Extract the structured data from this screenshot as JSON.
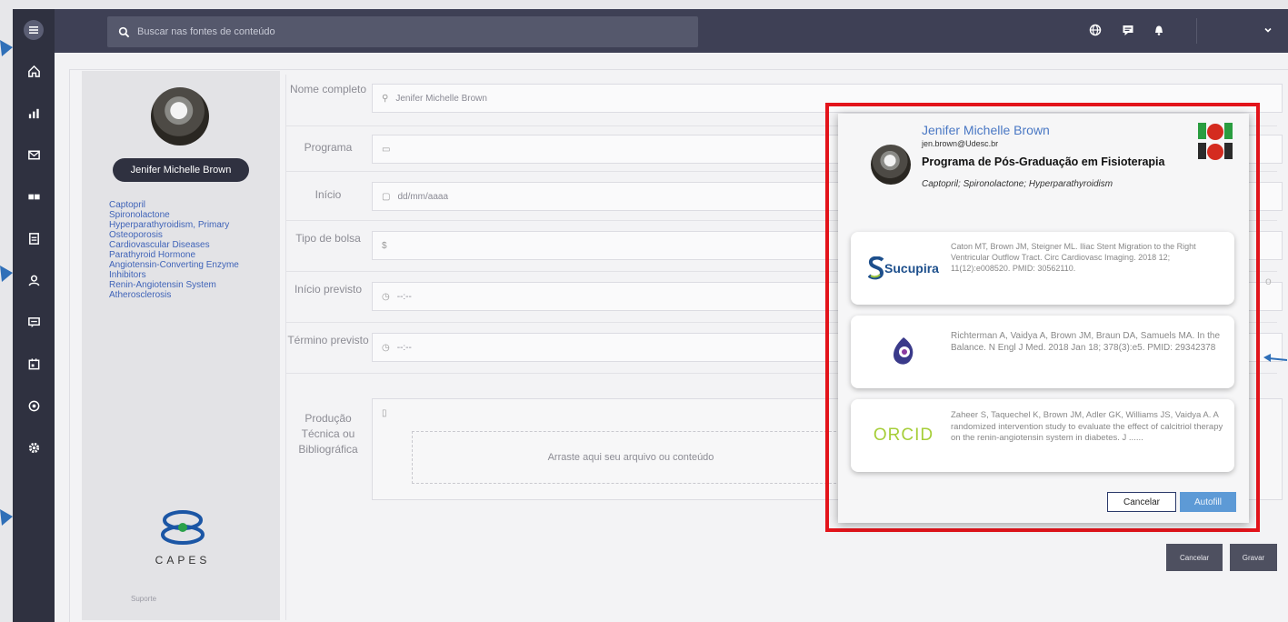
{
  "search": {
    "placeholder": "Buscar nas fontes de conteúdo"
  },
  "profile": {
    "name": "Jenifer Michelle Brown",
    "keywords": [
      "Captopril",
      "Spironolactone",
      "Hyperparathyroidism, Primary",
      "Osteoporosis",
      "Cardiovascular Diseases",
      "Parathyroid Hormone",
      "Angiotensin-Converting Enzyme",
      "Inhibitors",
      "Renin-Angiotensin System",
      "Atherosclerosis"
    ],
    "logo_text": "CAPES",
    "support": "Suporte"
  },
  "form": {
    "fields": [
      {
        "label": "Nome completo",
        "value": "Jenifer Michelle Brown",
        "icon": "person-icon"
      },
      {
        "label": "Programa",
        "value": "",
        "icon": "building-icon"
      },
      {
        "label": "Início",
        "value": "dd/mm/aaaa",
        "icon": "calendar-icon"
      },
      {
        "label": "Tipo de bolsa",
        "value": "",
        "icon": "dollar-icon"
      },
      {
        "label": "Início previsto",
        "value": "--:--",
        "icon": "clock-icon"
      },
      {
        "label": "Término previsto",
        "value": "--:--",
        "icon": "clock-icon"
      },
      {
        "label": "Produção Técnica ou Bibliográfica",
        "value": "",
        "icon": "file-icon"
      }
    ],
    "dropzone": "Arraste aqui seu arquivo ou conteúdo",
    "currency_symbol": "$",
    "cancel_label": "Cancelar",
    "save_label": "Gravar",
    "edge_char": "o"
  },
  "popup": {
    "name": "Jenifer Michelle Brown",
    "email": "jen.brown@Udesc.br",
    "program": "Programa de Pós-Graduação em Fisioterapia",
    "keywords": "Captopril; Spironolactone; Hyperparathyroidism",
    "sources": [
      {
        "logo": "Sucupira",
        "text": "Caton MT, Brown JM, Steigner ML. Iliac Stent Migration to the Right Ventricular Outflow Tract. Circ Cardiovasc Imaging. 2018 12; 11(12):e008520. PMID: 30562110."
      },
      {
        "logo": "PubMed",
        "text": "Richterman A, Vaidya A, Brown JM, Braun DA, Samuels MA. In the Balance. N Engl J Med. 2018 Jan 18; 378(3):e5. PMID: 29342378"
      },
      {
        "logo": "ORCID",
        "text": "Zaheer S, Taquechel K, Brown JM, Adler GK, Williams JS, Vaidya A. A randomized intervention study to evaluate the effect of calcitriol therapy on the renin-angiotensin system in diabetes. J ......"
      }
    ],
    "cancel_label": "Cancelar",
    "autofill_label": "Autofill"
  },
  "colors": {
    "sidebar": "#2f3140",
    "topbar": "#3e4055",
    "accent": "#4a78c4",
    "highlight": "#e3141b",
    "autofill": "#5d9ad6"
  }
}
